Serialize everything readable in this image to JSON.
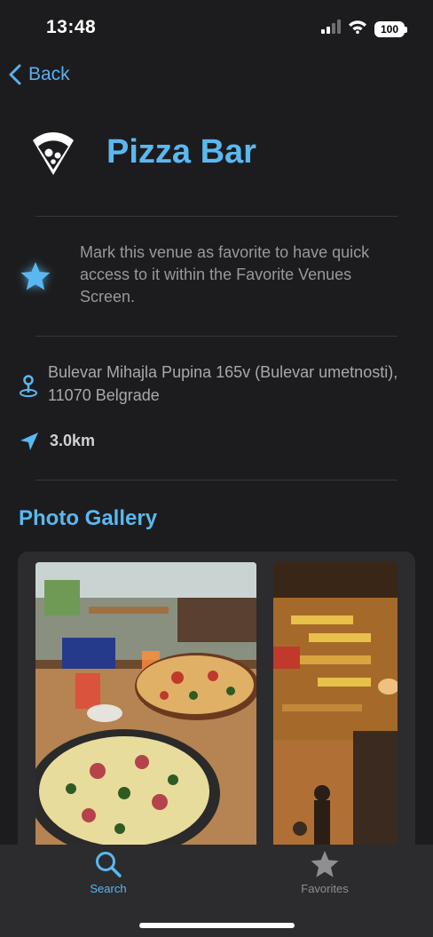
{
  "status_bar": {
    "time": "13:48",
    "battery": "100"
  },
  "nav": {
    "back_label": "Back"
  },
  "venue": {
    "title": "Pizza Bar",
    "favorite_hint": "Mark this venue as favorite to have quick access to it within the Favorite Venues Screen.",
    "address": "Bulevar Mihajla Pupina 165v (Bulevar umetnosti), 11070 Belgrade",
    "distance": "3.0km"
  },
  "gallery": {
    "title": "Photo Gallery"
  },
  "tab_bar": {
    "tabs": [
      {
        "label": "Search",
        "icon": "search-icon",
        "active": true
      },
      {
        "label": "Favorites",
        "icon": "star-icon",
        "active": false
      }
    ]
  },
  "colors": {
    "accent": "#5ab8f0",
    "background": "#1c1c1e",
    "card": "#2c2c2e"
  }
}
